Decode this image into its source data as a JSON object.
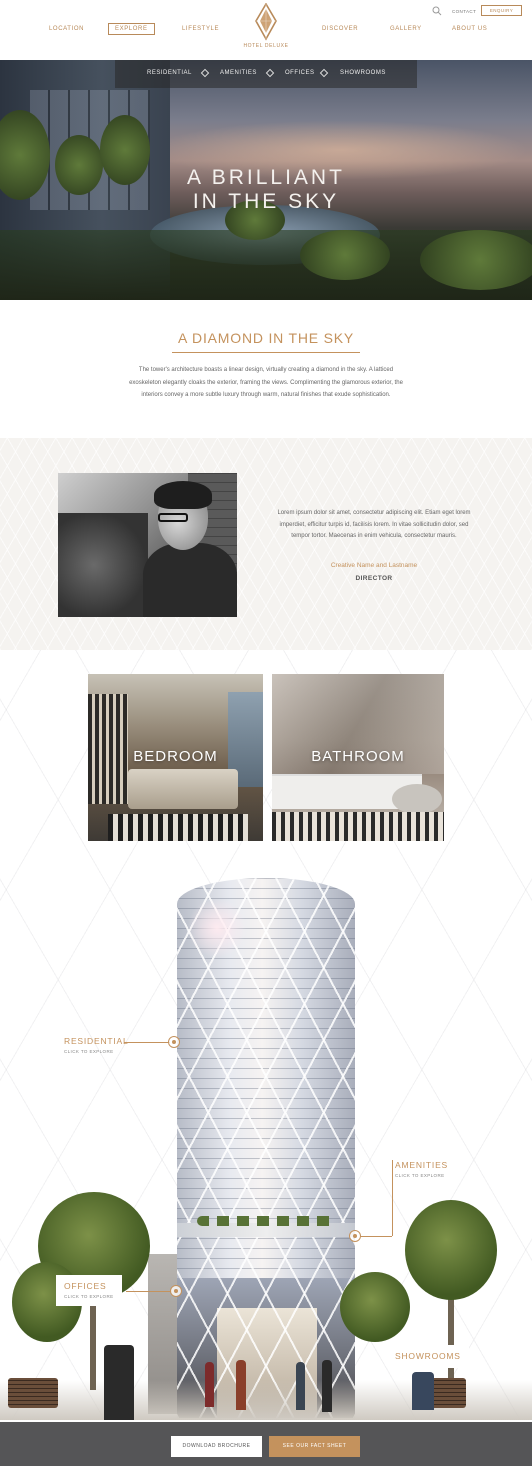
{
  "header": {
    "nav_left": [
      "LOCATION",
      "EXPLORE",
      "LIFESTYLE"
    ],
    "nav_right": [
      "DISCOVER",
      "GALLERY",
      "ABOUT US"
    ],
    "active": "EXPLORE",
    "brand": "HOTEL DELUXE",
    "contact": "CONTACT",
    "enquiry": "ENQUIRY",
    "accent": "#b88a5a"
  },
  "hero": {
    "subnav": [
      "RESIDENTIAL",
      "AMENITIES",
      "OFFICES",
      "SHOWROOMS"
    ],
    "title_line1": "A BRILLIANT",
    "title_line2": "IN THE SKY"
  },
  "intro": {
    "title": "A DIAMOND IN THE SKY",
    "text": "The tower's architecture boasts a linear design, virtually creating a diamond in the sky. A latticed exoskeleton elegantly cloaks the exterior, framing the views. Complimenting the glamorous exterior, the interiors convey a more subtle luxury through warm, natural finishes that exude sophistication."
  },
  "quote": {
    "text": "Lorem ipsum dolor sit amet, consectetur adipiscing elit. Etiam eget lorem imperdiet, efficitur turpis id, facilisis lorem. In vitae sollicitudin dolor, sed tempor tortor. Maecenas in enim vehicula, consectetur mauris.",
    "name": "Creative Name and Lastname",
    "role": "DIRECTOR"
  },
  "rooms": {
    "bedroom": "BEDROOM",
    "bathroom": "BATHROOM"
  },
  "hotspots": {
    "residential": {
      "name": "RESIDENTIAL",
      "sub": "CLICK TO EXPLORE"
    },
    "amenities": {
      "name": "AMENITIES",
      "sub": "CLICK TO EXPLORE"
    },
    "offices": {
      "name": "OFFICES",
      "sub": "CLICK TO EXPLORE"
    },
    "showrooms": {
      "name": "SHOWROOMS"
    }
  },
  "footer": {
    "brochure": "DOWNLOAD BROCHURE",
    "fact_sheet": "SEE OUR FACT SHEET"
  },
  "colors": {
    "gold": "#c4925d",
    "footer_bg": "#555557"
  },
  "icons": [
    "search-icon",
    "logo-diamond-icon",
    "diamond-separator-icon"
  ]
}
